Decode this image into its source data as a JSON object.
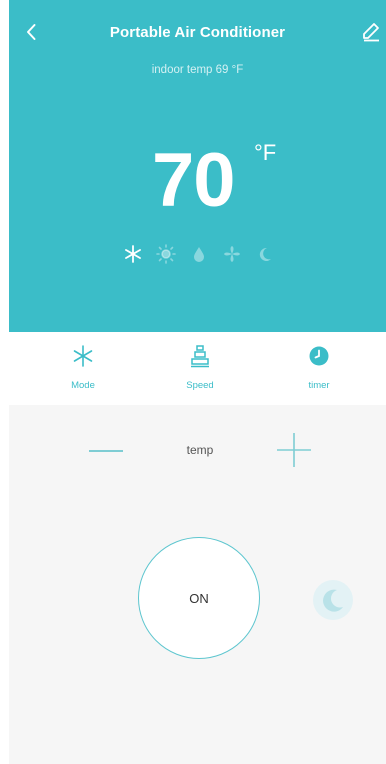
{
  "header": {
    "title": "Portable Air Conditioner",
    "indoor_temp": "indoor temp 69 °F",
    "back_icon": "chevron-left-icon",
    "edit_icon": "pencil-icon"
  },
  "display": {
    "set_temp": "70",
    "unit": "°F",
    "modes": [
      {
        "name": "cool",
        "icon": "snowflake-icon",
        "active": true
      },
      {
        "name": "heat",
        "icon": "sun-icon",
        "active": false
      },
      {
        "name": "dry",
        "icon": "droplet-icon",
        "active": false
      },
      {
        "name": "fan",
        "icon": "fan-icon",
        "active": false
      },
      {
        "name": "sleep",
        "icon": "moon-icon",
        "active": false
      }
    ]
  },
  "functions": [
    {
      "label": "Mode",
      "icon": "snowflake-icon"
    },
    {
      "label": "Speed",
      "icon": "speed-icon"
    },
    {
      "label": "timer",
      "icon": "clock-icon"
    }
  ],
  "controls": {
    "temp_label": "temp",
    "power_label": "ON",
    "sleep_icon": "moon-icon"
  },
  "colors": {
    "accent": "#3bbdc8",
    "background": "#f6f6f6",
    "function_bar": "#ffffff"
  }
}
